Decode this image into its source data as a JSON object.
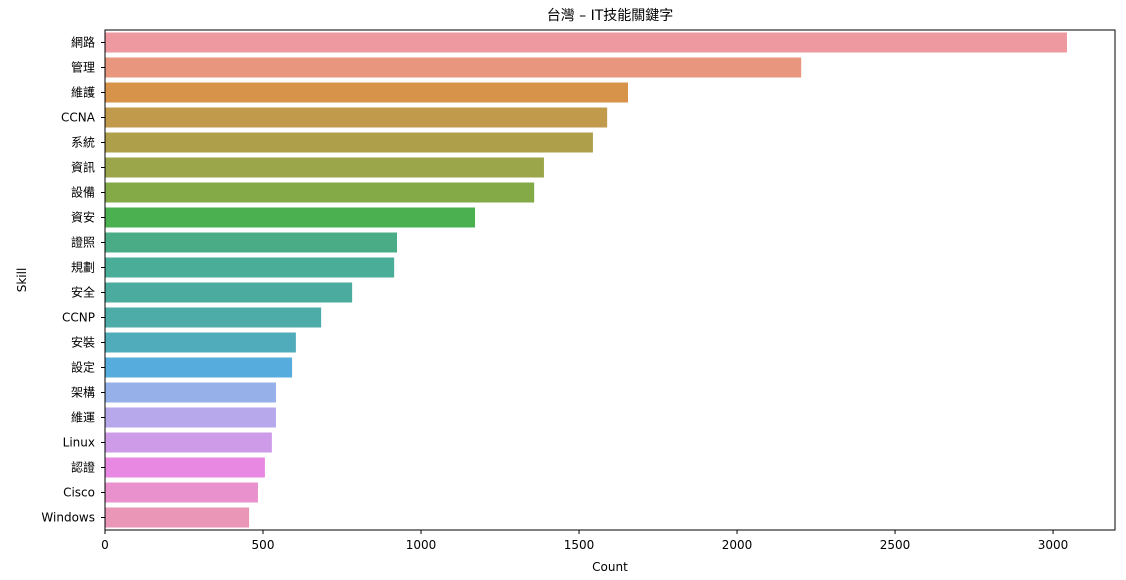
{
  "chart_data": {
    "type": "bar",
    "orientation": "horizontal",
    "title": "台灣 – IT技能關鍵字",
    "xlabel": "Count",
    "ylabel": "Skill",
    "xlim": [
      0,
      3196
    ],
    "xticks": [
      0,
      500,
      1000,
      1500,
      2000,
      2500,
      3000
    ],
    "grid": false,
    "legend": "none",
    "categories": [
      "網路",
      "管理",
      "維護",
      "CCNA",
      "系統",
      "資訊",
      "設備",
      "資安",
      "證照",
      "規劃",
      "安全",
      "CCNP",
      "安裝",
      "設定",
      "架構",
      "維運",
      "Linux",
      "認證",
      "Cisco",
      "Windows"
    ],
    "values": [
      3044,
      2203,
      1655,
      1589,
      1544,
      1389,
      1358,
      1171,
      924,
      915,
      782,
      684,
      604,
      592,
      541,
      541,
      528,
      506,
      484,
      456
    ],
    "colors": [
      "#ee99a0",
      "#e9967f",
      "#d8934b",
      "#c19a4b",
      "#ae9f4b",
      "#9ba64a",
      "#84aa48",
      "#4bb050",
      "#4aac87",
      "#4aad98",
      "#4cab9f",
      "#4daba8",
      "#50acbb",
      "#56acdc",
      "#96b0e9",
      "#b7a8ec",
      "#cd9be8",
      "#e888e3",
      "#e891cc",
      "#e996b7"
    ]
  }
}
